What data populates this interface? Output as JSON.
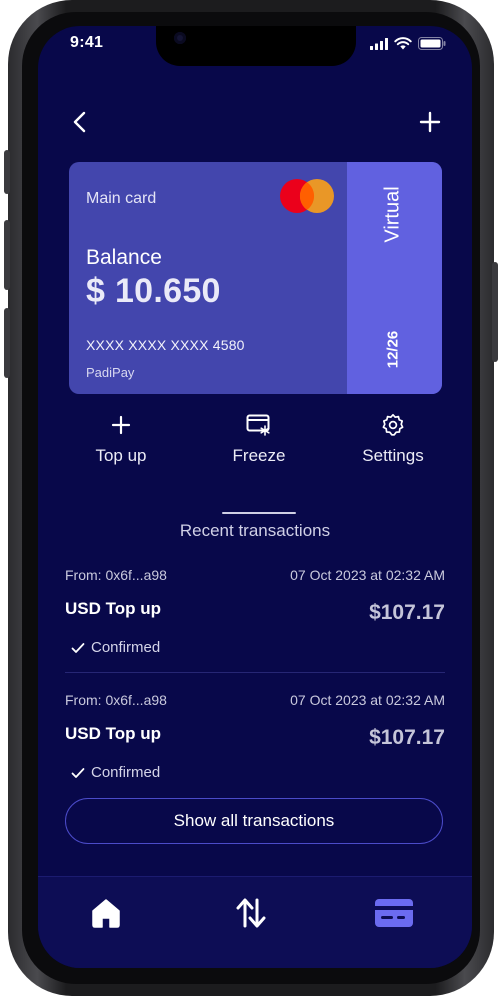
{
  "status_bar": {
    "time": "9:41",
    "icons": [
      "signal-icon",
      "wifi-icon",
      "battery-icon"
    ]
  },
  "header": {
    "back_icon": "chevron-left-icon",
    "add_icon": "plus-icon"
  },
  "card": {
    "label": "Main card",
    "network_icon": "mastercard-logo",
    "balance_label": "Balance",
    "balance_value": "$ 10.650",
    "number": "XXXX XXXX XXXX 4580",
    "brand": "PadiPay",
    "type": "Virtual",
    "expiry": "12/26",
    "colors": {
      "card": "#4346ad",
      "side": "#6161e0",
      "mc_red": "#eb001b",
      "mc_orange": "#f79e1b"
    }
  },
  "actions": [
    {
      "label": "Top up",
      "icon": "plus-icon"
    },
    {
      "label": "Freeze",
      "icon": "card-freeze-icon"
    },
    {
      "label": "Settings",
      "icon": "gear-icon"
    }
  ],
  "recent": {
    "title": "Recent transactions",
    "transactions": [
      {
        "from": "From: 0x6f...a98",
        "date": "07 Oct 2023 at 02:32 AM",
        "type": "USD Top up",
        "amount": "$107.17",
        "status": "Confirmed"
      },
      {
        "from": "From: 0x6f...a98",
        "date": "07 Oct 2023 at 02:32 AM",
        "type": "USD Top up",
        "amount": "$107.17",
        "status": "Confirmed"
      }
    ],
    "show_all_label": "Show all transactions"
  },
  "bottom_nav": {
    "items": [
      {
        "icon": "home-icon",
        "active": false
      },
      {
        "icon": "transfer-arrows-icon",
        "active": false
      },
      {
        "icon": "card-icon",
        "active": true
      }
    ],
    "active_color": "#6b6bf0"
  },
  "theme": {
    "background": "#08084a",
    "accent": "#4b4bc9"
  }
}
